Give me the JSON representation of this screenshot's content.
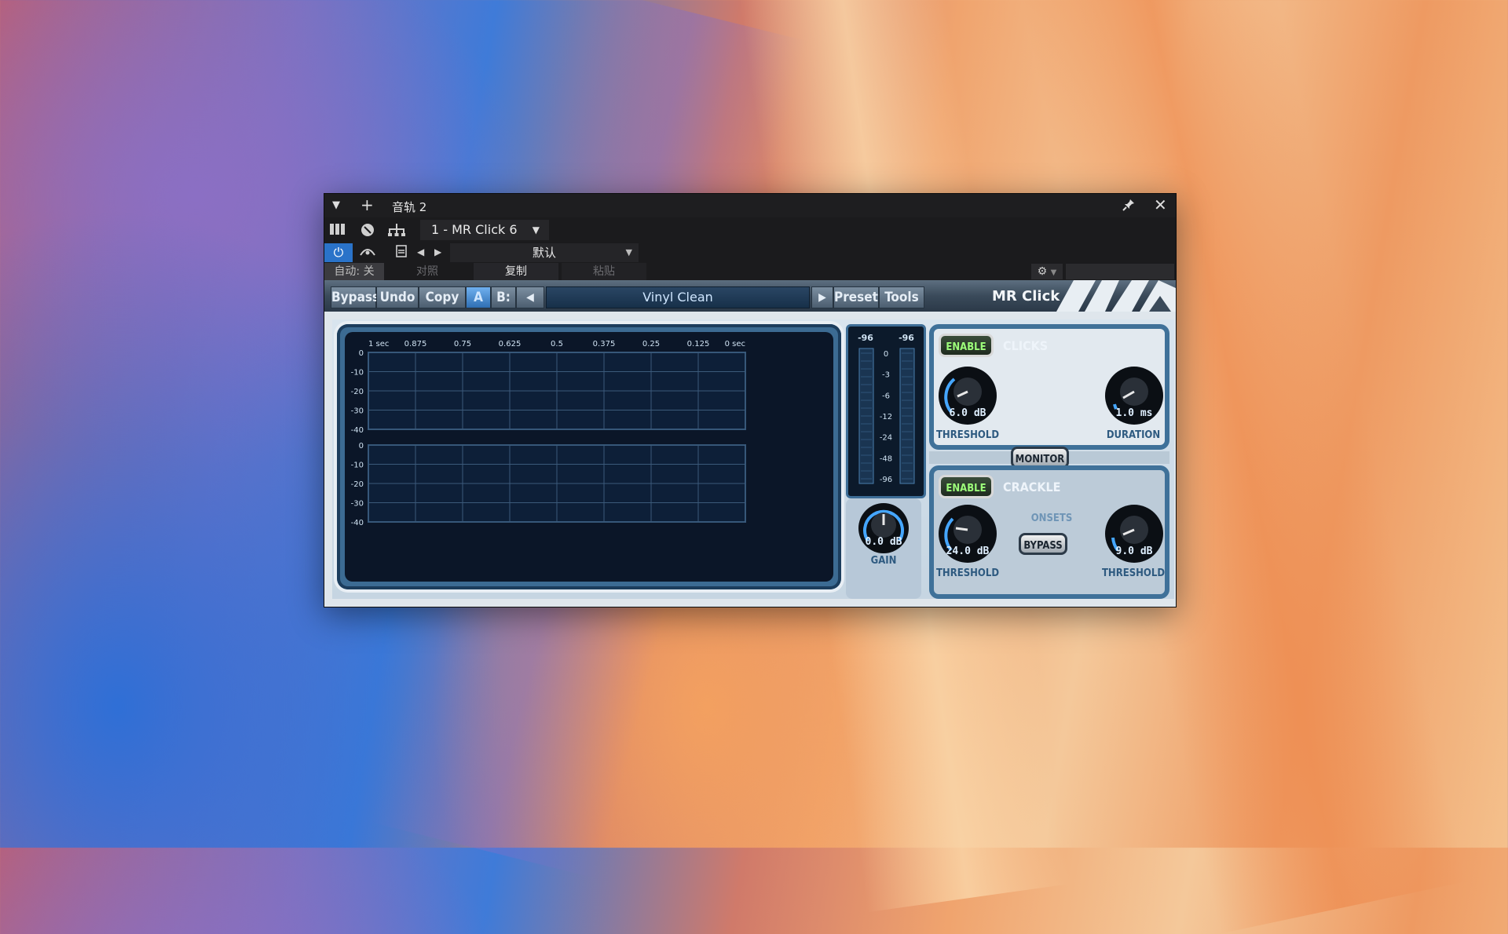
{
  "window": {
    "title": "音轨 2",
    "plugin_selector": "1 - MR Click 6",
    "preset_mode": "默认",
    "auto_label": "自动: 关",
    "compare_label": "对照",
    "copy_label": "复制",
    "paste_label": "粘贴"
  },
  "plugin": {
    "toolbar": {
      "bypass": "Bypass",
      "undo": "Undo",
      "copy": "Copy",
      "a": "A",
      "b": "B:",
      "preset_name": "Vinyl Clean",
      "preset": "Preset",
      "tools": "Tools"
    },
    "brand": "MR Click",
    "graph": {
      "time_ticks": [
        "1 sec",
        "0.875",
        "0.75",
        "0.625",
        "0.5",
        "0.375",
        "0.25",
        "0.125",
        "0 sec"
      ],
      "top_db_ticks": [
        "0",
        "-10",
        "-20",
        "-30",
        "-40"
      ],
      "bottom_db_ticks": [
        "0",
        "-10",
        "-20",
        "-30",
        "-40"
      ]
    },
    "meter": {
      "left_peak": "-96",
      "right_peak": "-96",
      "scale": [
        "0",
        "-3",
        "-6",
        "-12",
        "-24",
        "-48",
        "-96"
      ]
    },
    "gain": {
      "value": "0.0 dB",
      "label": "GAIN"
    },
    "clicks": {
      "enable": "ENABLE",
      "title": "CLICKS",
      "threshold": {
        "value": "6.0 dB",
        "label": "THRESHOLD"
      },
      "duration": {
        "value": "1.0 ms",
        "label": "DURATION"
      }
    },
    "monitor": "MONITOR",
    "crackle": {
      "enable": "ENABLE",
      "title": "CRACKLE",
      "onsets": "ONSETS",
      "bypass": "BYPASS",
      "threshold1": {
        "value": "24.0 dB",
        "label": "THRESHOLD"
      },
      "threshold2": {
        "value": "9.0 dB",
        "label": "THRESHOLD"
      }
    }
  }
}
